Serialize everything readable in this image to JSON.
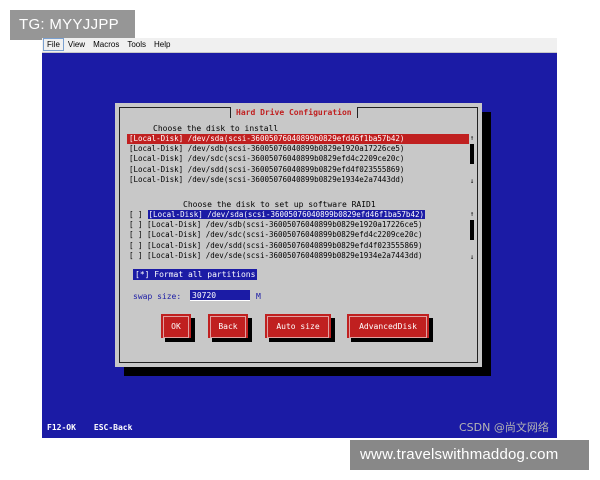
{
  "overlay": {
    "tg": "TG: MYYJJPP",
    "url": "www.travelswithmaddog.com",
    "csdn": "CSDN @尚文网络"
  },
  "menubar": {
    "items": [
      "File",
      "View",
      "Macros",
      "Tools",
      "Help"
    ]
  },
  "dialog": {
    "title": "Hard Drive Configuration",
    "install_label": "Choose the disk to install",
    "install_disks": [
      "[Local-Disk] /dev/sda(scsi-36005076040899b0829efd46f1ba57b42)",
      "[Local-Disk] /dev/sdb(scsi-36005076040899b0829e1920a17226ce5)",
      "[Local-Disk] /dev/sdc(scsi-36005076040899b0829efd4c2209ce20c)",
      "[Local-Disk] /dev/sdd(scsi-36005076040899b0829efd4f023555869)",
      "[Local-Disk] /dev/sde(scsi-36005076040899b0829e1934e2a7443dd)"
    ],
    "install_scroll": {
      "up": "↑",
      "down": "↓"
    },
    "raid_label": "Choose the disk to set up software RAID1",
    "raid_disks": [
      "[ ] [Local-Disk] /dev/sda(scsi-36005076040899b0829efd46f1ba57b42)",
      "[ ] [Local-Disk] /dev/sdb(scsi-36005076040899b0829e1920a17226ce5)",
      "[ ] [Local-Disk] /dev/sdc(scsi-36005076040899b0829efd4c2209ce20c)",
      "[ ] [Local-Disk] /dev/sdd(scsi-36005076040899b0829efd4f023555869)",
      "[ ] [Local-Disk] /dev/sde(scsi-36005076040899b0829e1934e2a7443dd)"
    ],
    "raid_scroll": {
      "up": "↑",
      "down": "↓"
    },
    "format_option": "[*] Format all partitions",
    "swap_label": "swap size:",
    "swap_value": "30720",
    "swap_unit": "M",
    "buttons": {
      "ok": "OK",
      "back": "Back",
      "auto_size": "Auto size",
      "advanced": "AdvancedDisk"
    }
  },
  "statusbar": {
    "f12": "F12-OK",
    "esc": "ESC-Back"
  },
  "colors": {
    "screen_bg": "#1b1ba5",
    "dialog_bg": "#c8c8c8",
    "accent_red": "#c02020"
  }
}
